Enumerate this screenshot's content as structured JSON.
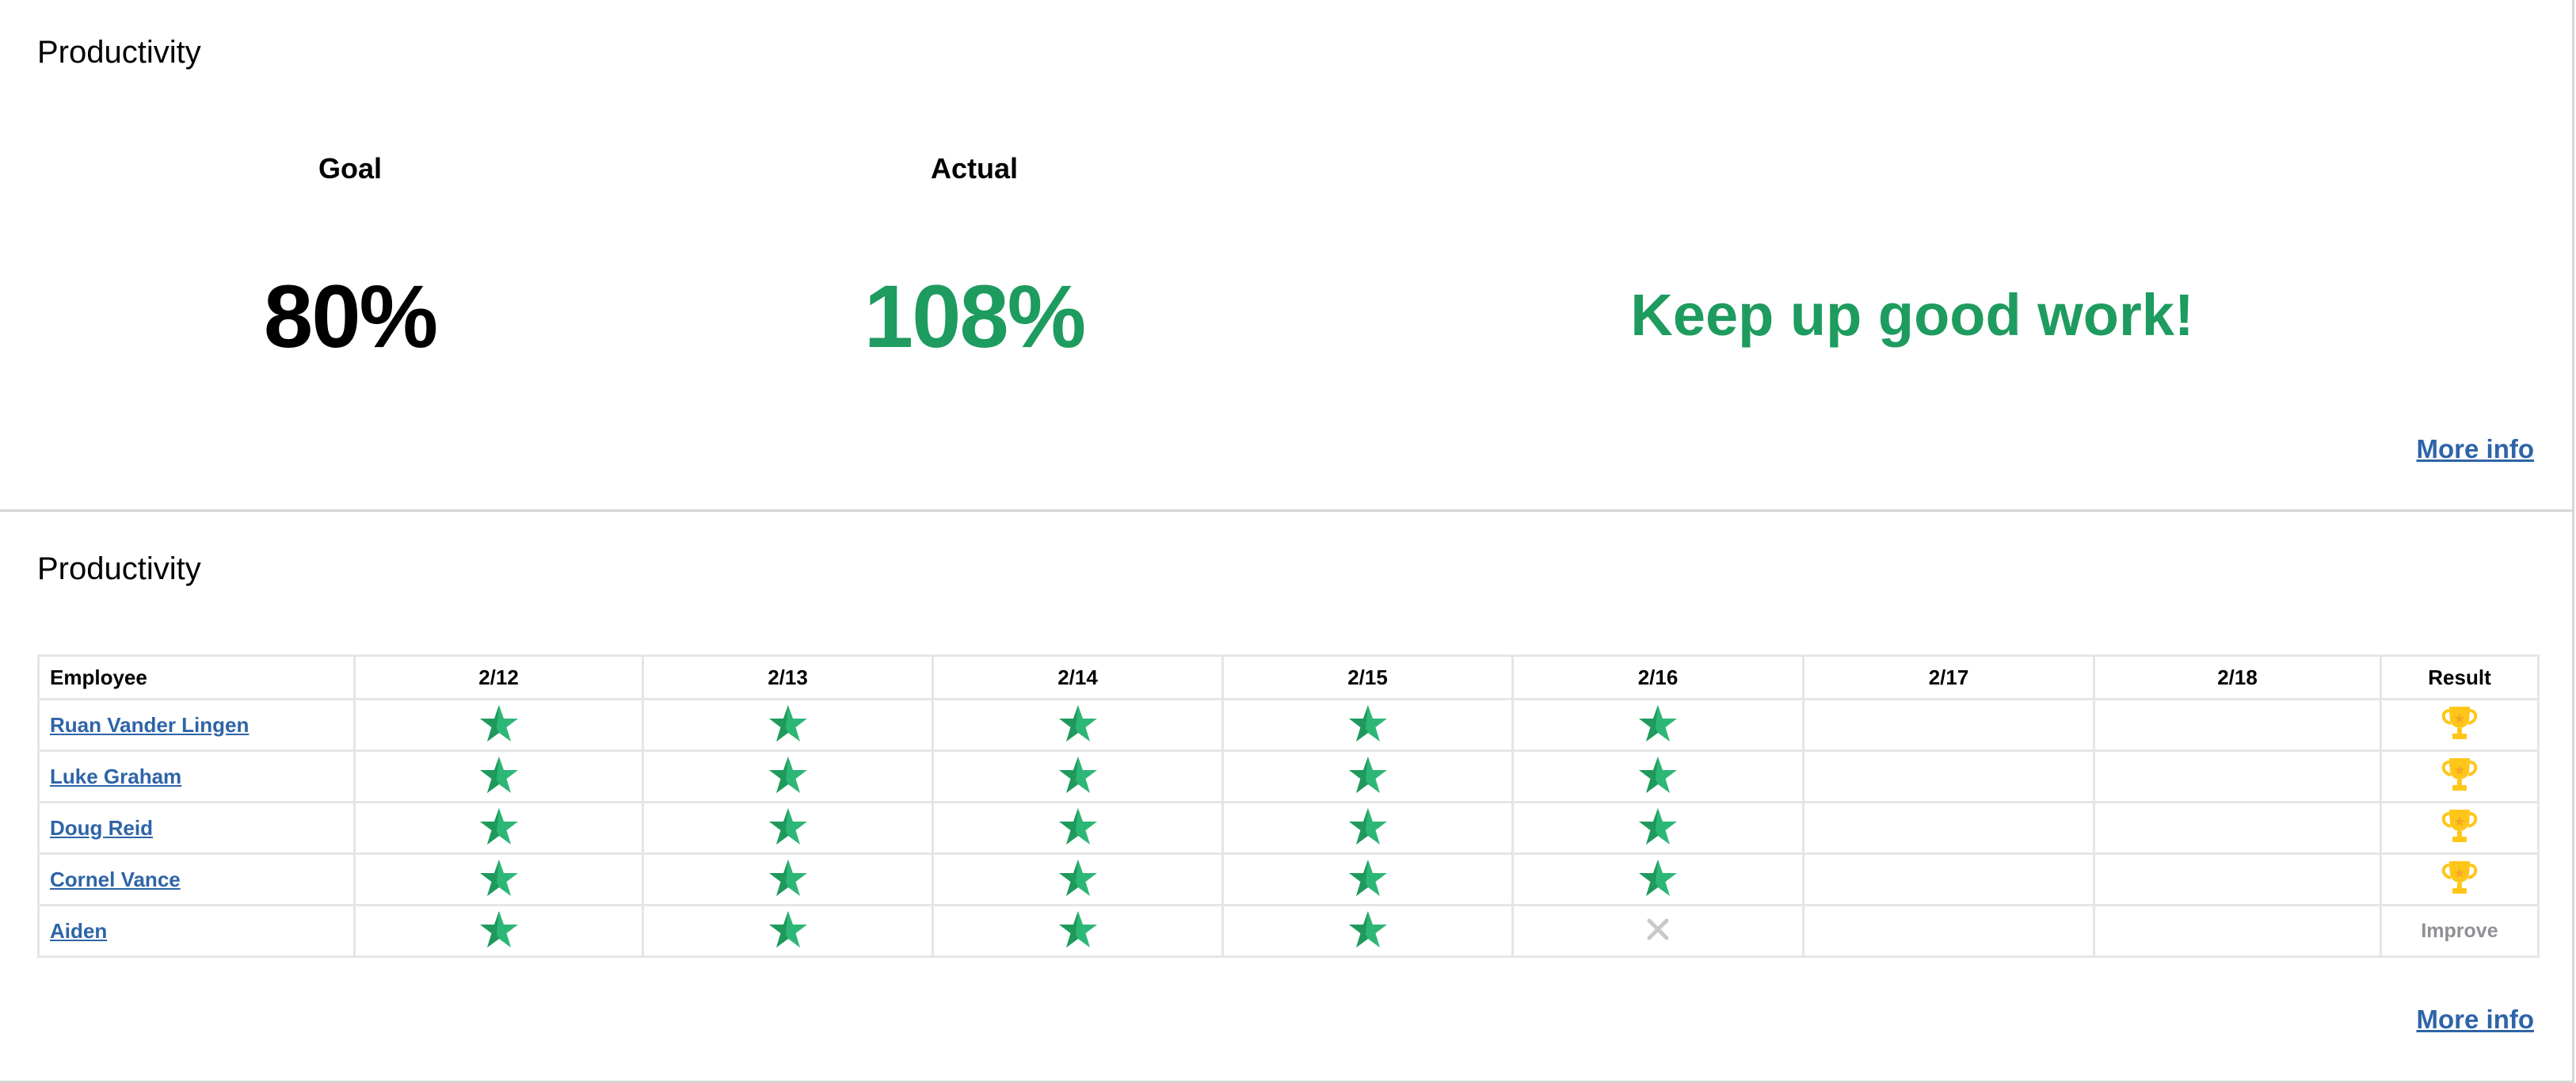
{
  "colors": {
    "success_green": "#1e9b5f",
    "star_light": "#2db776",
    "star_dark": "#1f9a5c",
    "link_blue": "#2e64a8",
    "trophy_gold": "#ffc61a",
    "trophy_star": "#f5a623",
    "cross_gray": "#c8c8c8",
    "improve_gray": "#8f9094",
    "border_gray": "#e6e6e6"
  },
  "summary_panel": {
    "title": "Productivity",
    "goal_label": "Goal",
    "goal_value": "80%",
    "actual_label": "Actual",
    "actual_value": "108%",
    "message": "Keep up good work!",
    "more_info": "More info"
  },
  "detail_panel": {
    "title": "Productivity",
    "more_info": "More info",
    "table": {
      "columns": [
        "Employee",
        "2/12",
        "2/13",
        "2/14",
        "2/15",
        "2/16",
        "2/17",
        "2/18",
        "Result"
      ],
      "rows": [
        {
          "employee": "Ruan Vander Lingen",
          "days": [
            "star",
            "star",
            "star",
            "star",
            "star",
            "",
            ""
          ],
          "result": "trophy",
          "result_text": ""
        },
        {
          "employee": "Luke Graham",
          "days": [
            "star",
            "star",
            "star",
            "star",
            "star",
            "",
            ""
          ],
          "result": "trophy",
          "result_text": ""
        },
        {
          "employee": "Doug Reid",
          "days": [
            "star",
            "star",
            "star",
            "star",
            "star",
            "",
            ""
          ],
          "result": "trophy",
          "result_text": ""
        },
        {
          "employee": "Cornel Vance",
          "days": [
            "star",
            "star",
            "star",
            "star",
            "star",
            "",
            ""
          ],
          "result": "trophy",
          "result_text": ""
        },
        {
          "employee": "Aiden",
          "days": [
            "star",
            "star",
            "star",
            "star",
            "cross",
            "",
            ""
          ],
          "result": "text",
          "result_text": "Improve"
        }
      ]
    }
  }
}
